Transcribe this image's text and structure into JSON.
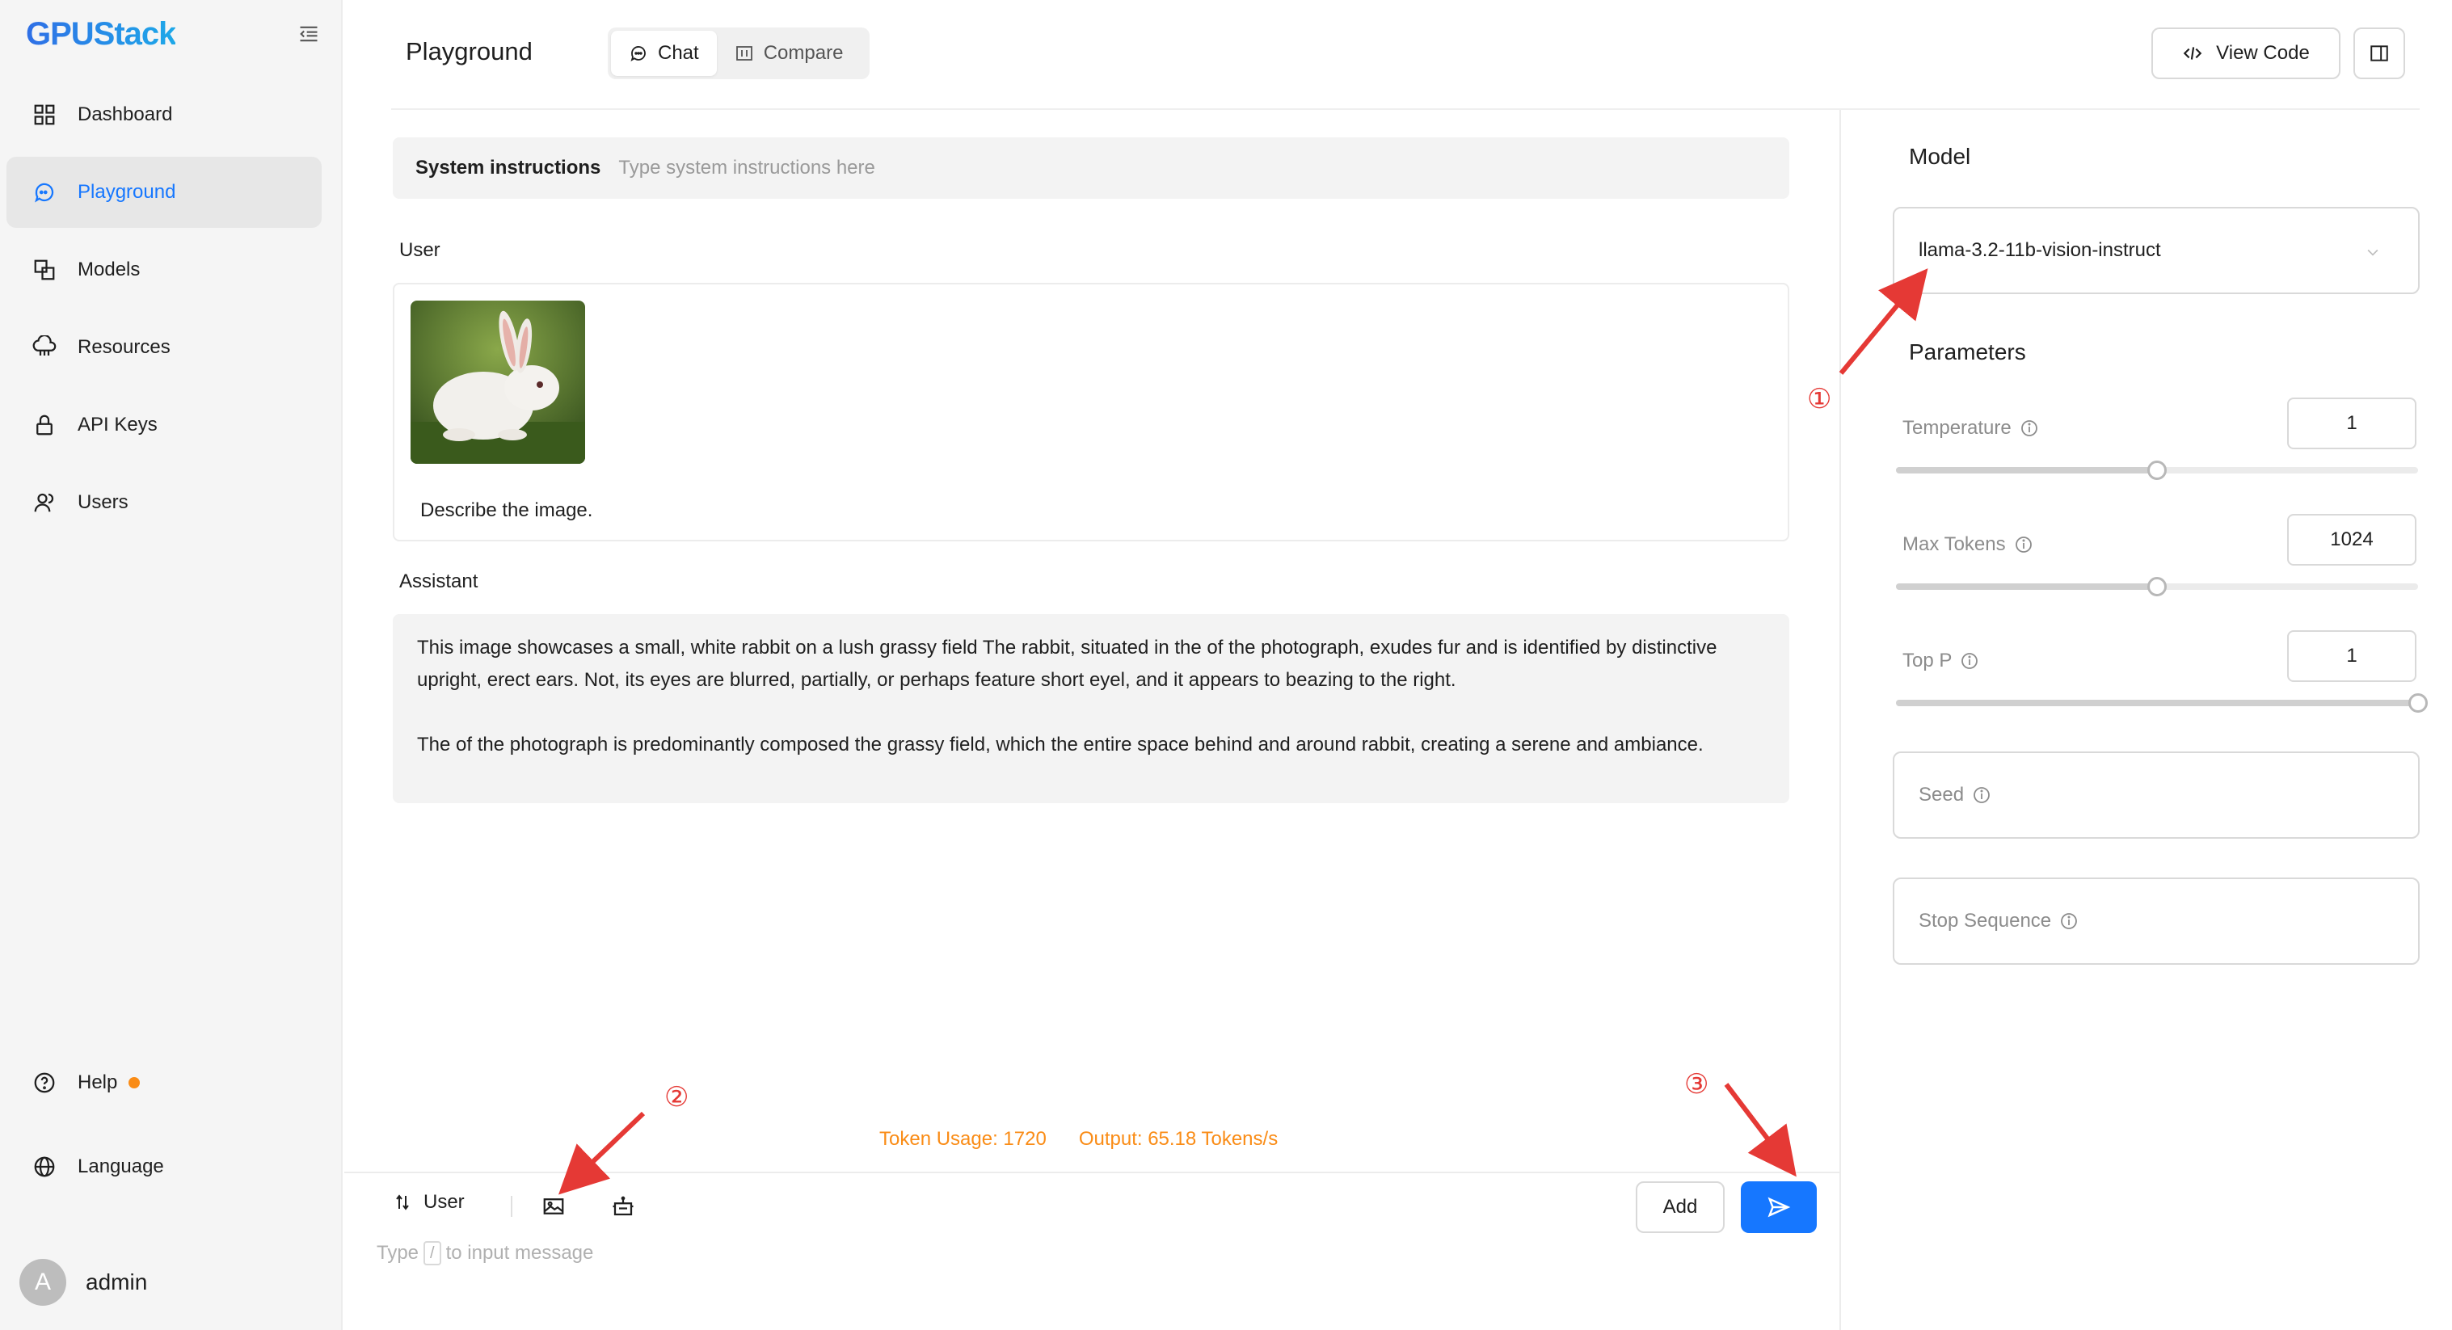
{
  "app": {
    "logo": "GPUStack"
  },
  "sidebar": {
    "items": [
      {
        "label": "Dashboard",
        "icon": "dashboard-icon"
      },
      {
        "label": "Playground",
        "icon": "playground-icon",
        "active": true
      },
      {
        "label": "Models",
        "icon": "models-icon"
      },
      {
        "label": "Resources",
        "icon": "resources-icon"
      },
      {
        "label": "API Keys",
        "icon": "lock-icon"
      },
      {
        "label": "Users",
        "icon": "users-icon"
      }
    ],
    "help_label": "Help",
    "language_label": "Language",
    "user": {
      "avatar_letter": "A",
      "name": "admin"
    }
  },
  "header": {
    "title": "Playground",
    "tabs": [
      {
        "label": "Chat",
        "icon": "chat-icon",
        "active": true
      },
      {
        "label": "Compare",
        "icon": "compare-icon"
      }
    ],
    "view_code_label": "View Code"
  },
  "chat": {
    "system_label": "System instructions",
    "system_placeholder": "Type system instructions here",
    "user_role": "User",
    "user_message": "Describe the image.",
    "assistant_role": "Assistant",
    "assistant_paragraphs": [
      "This image showcases a small, white rabbit on a lush grassy field The rabbit, situated in the of the photograph, exudes fur and is identified by distinctive upright, erect ears. Not, its eyes are blurred, partially, or perhaps feature short eyel, and it appears to beazing to the right.",
      "The of the photograph is predominantly composed the grassy field, which the entire space behind and around rabbit, creating a serene and ambiance."
    ],
    "token_usage": "Token Usage: 1720",
    "output_speed": "Output: 65.18 Tokens/s"
  },
  "composer": {
    "role_label": "User",
    "add_label": "Add",
    "placeholder_prefix": "Type",
    "placeholder_key": "/",
    "placeholder_suffix": "to input message"
  },
  "panel": {
    "model_heading": "Model",
    "model_value": "llama-3.2-11b-vision-instruct",
    "params_heading": "Parameters",
    "temperature": {
      "label": "Temperature",
      "value": "1",
      "level": 0.5
    },
    "max_tokens": {
      "label": "Max Tokens",
      "value": "1024",
      "level": 0.5
    },
    "top_p": {
      "label": "Top P",
      "value": "1",
      "level": 1.0
    },
    "seed_label": "Seed",
    "stop_label": "Stop Sequence"
  },
  "annotations": [
    "①",
    "②",
    "③"
  ],
  "colors": {
    "accent": "#1677ff",
    "token": "#fa8c16",
    "annotation": "#e53935"
  }
}
